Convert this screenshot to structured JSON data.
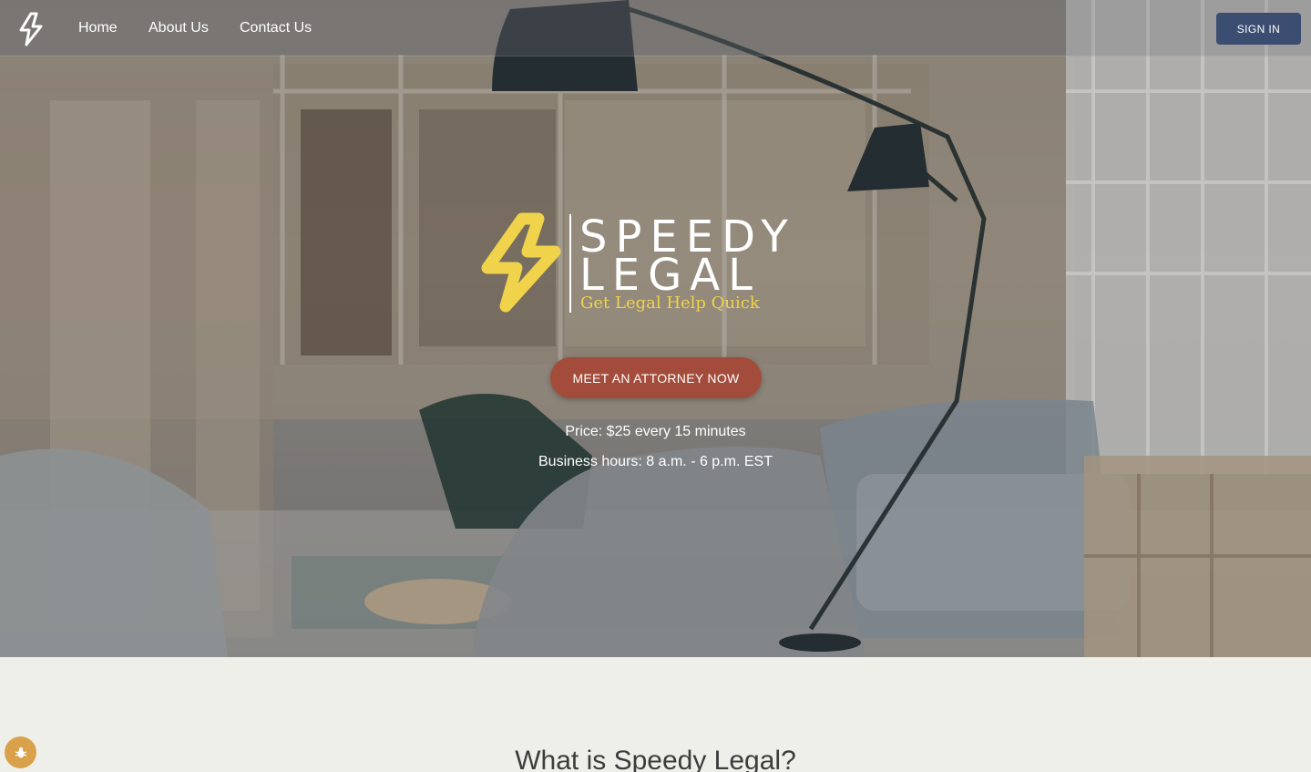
{
  "nav": {
    "links": [
      "Home",
      "About Us",
      "Contact Us"
    ],
    "signin_label": "SIGN IN"
  },
  "brand": {
    "line1": "SPEEDY",
    "line2": "LEGAL",
    "tagline": "Get Legal Help Quick"
  },
  "hero": {
    "cta_label": "MEET AN ATTORNEY NOW",
    "price": "Price: $25 every 15 minutes",
    "hours": "Business hours: 8 a.m. - 6 p.m. EST"
  },
  "section": {
    "heading": "What is Speedy Legal?"
  },
  "colors": {
    "signin_bg": "#3b4d70",
    "cta_bg": "#a44c3b",
    "brand_yellow": "#f0d34a",
    "page_bg": "#efefea",
    "bug_button_bg": "#d9a24a"
  },
  "icons": {
    "nav_logo": "lightning-bolt-icon",
    "brand_mark": "lightning-bolt-icon",
    "bug_button": "bug-icon"
  }
}
